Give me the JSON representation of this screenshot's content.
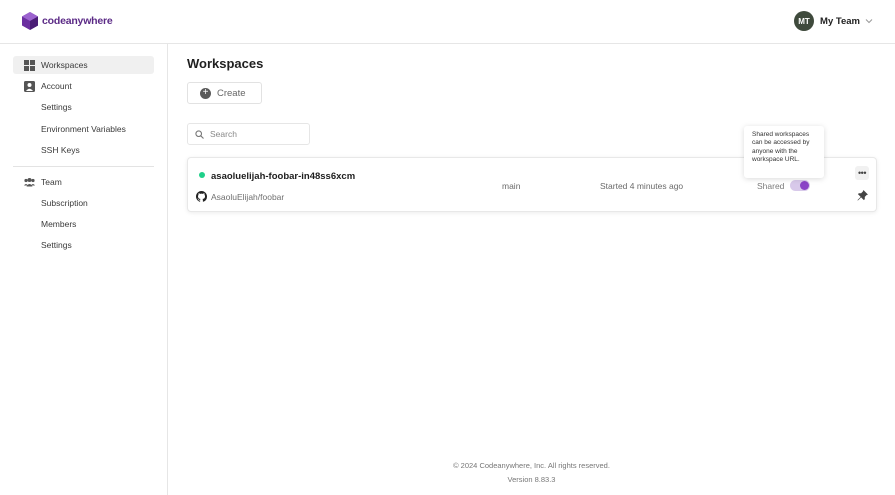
{
  "header": {
    "logo_text": "codeanywhere",
    "avatar_initials": "MT",
    "team_name": "My Team",
    "brand_color": "#5b2a86"
  },
  "sidebar": {
    "items": [
      {
        "label": "Workspaces",
        "icon": "grid-icon",
        "active": true
      },
      {
        "label": "Account",
        "icon": "user-icon"
      },
      {
        "label": "Settings"
      },
      {
        "label": "Environment Variables"
      },
      {
        "label": "SSH Keys"
      },
      {
        "label": "Team",
        "icon": "team-icon"
      },
      {
        "label": "Subscription"
      },
      {
        "label": "Members"
      },
      {
        "label": "Settings"
      }
    ]
  },
  "main": {
    "title": "Workspaces",
    "create_label": "Create",
    "search_placeholder": "Search",
    "workspaces": [
      {
        "name": "asaoluelijah-foobar-in48ss6xcm",
        "repo": "AsaoluElijah/foobar",
        "branch": "main",
        "started": "Started 4 minutes ago",
        "shared_label": "Shared",
        "shared": true,
        "status_color": "#1fd08a"
      }
    ],
    "tooltip": "Shared workspaces can be accessed by anyone with the workspace URL."
  },
  "footer": {
    "copyright": "© 2024 Codeanywhere, Inc. All rights reserved.",
    "version": "Version 8.83.3"
  }
}
